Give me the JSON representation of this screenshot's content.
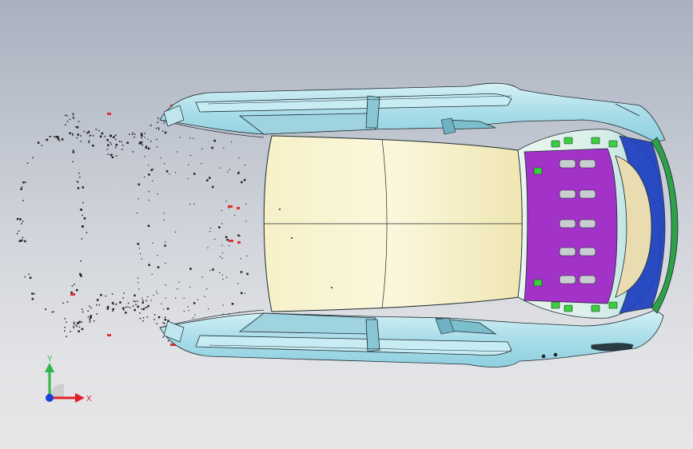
{
  "viewport": {
    "background_top": "#a9b1bf",
    "background_bottom": "#e6e6e8"
  },
  "model": {
    "body_color": "#b8e4ee",
    "roof_color": "#f4efc0",
    "panel_color": "#a232c8",
    "clip_color": "#3ccf3c",
    "edge_color": "#1e2a30",
    "point_color": "#222222",
    "marker_color": "#e23030"
  },
  "triad": {
    "x_label": "X",
    "y_label": "Y",
    "x_color": "#e0202a",
    "y_color": "#2fb54a",
    "origin_color": "#1a3fd6"
  }
}
